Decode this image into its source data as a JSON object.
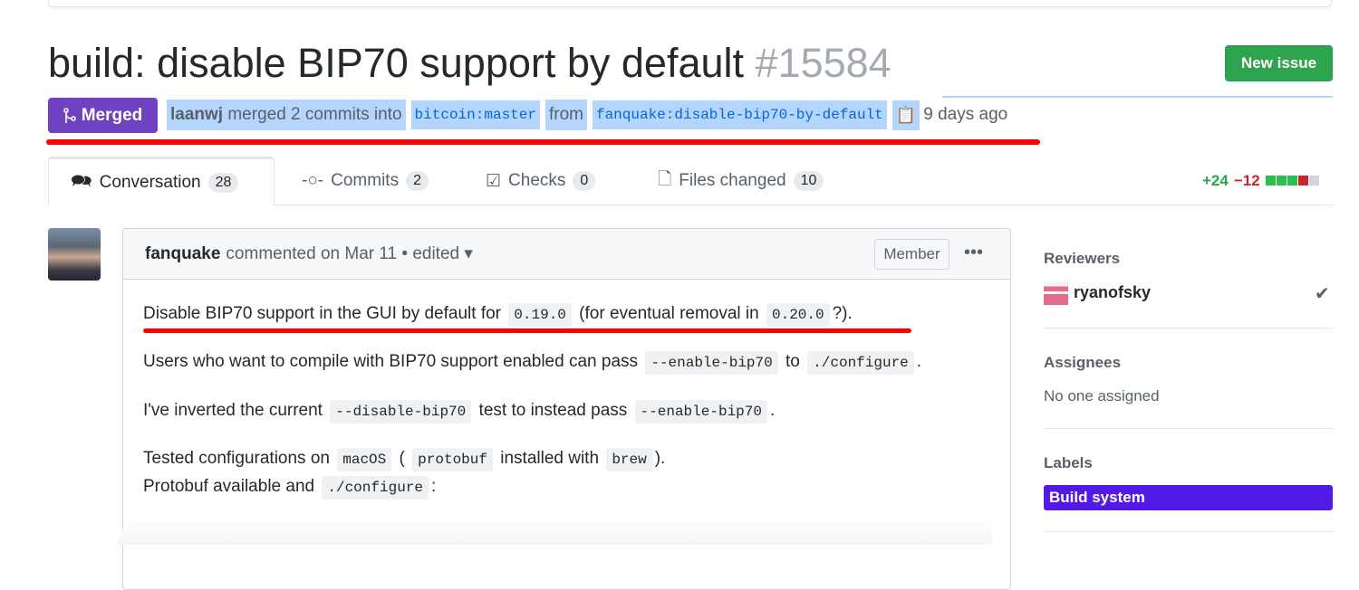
{
  "title": {
    "text": "build: disable BIP70 support by default",
    "number": "#15584"
  },
  "new_issue_label": "New issue",
  "meta": {
    "status": "Merged",
    "user": "laanwj",
    "action": "merged 2 commits into",
    "base": "bitcoin:master",
    "from": "from",
    "head": "fanquake:disable-bip70-by-default",
    "time": "9 days ago"
  },
  "tabs": [
    {
      "label": "Conversation",
      "count": "28",
      "icon": "comment-icon"
    },
    {
      "label": "Commits",
      "count": "2",
      "icon": "commit-icon"
    },
    {
      "label": "Checks",
      "count": "0",
      "icon": "checklist-icon"
    },
    {
      "label": "Files changed",
      "count": "10",
      "icon": "file-diff-icon"
    }
  ],
  "diffstat": {
    "additions": "+24",
    "deletions": "−12",
    "blocks": [
      "green",
      "green",
      "green",
      "red",
      "gray"
    ],
    "colors": {
      "green": "#2cbe4e",
      "red": "#cb2431",
      "gray": "#d1d5da"
    }
  },
  "comment": {
    "author": "fanquake",
    "meta": "commented on Mar 11",
    "edited": "• edited ▾",
    "role": "Member",
    "menu": "•••",
    "p1": {
      "a": "Disable BIP70 support in the GUI by default for",
      "c1": "0.19.0",
      "b": "(for eventual removal in",
      "c2": "0.20.0",
      "d": "?)."
    },
    "p2": {
      "a": "Users who want to compile with BIP70 support enabled can pass",
      "c1": "--enable-bip70",
      "b": "to",
      "c2": "./configure",
      "d": "."
    },
    "p3": {
      "a": "I've inverted the current",
      "c1": "--disable-bip70",
      "b": "test to instead pass",
      "c2": "--enable-bip70",
      "d": "."
    },
    "p4": {
      "a": "Tested configurations on",
      "c1": "macOS",
      "b": "(",
      "c2": "protobuf",
      "d": "installed with",
      "c3": "brew",
      "e": ")."
    },
    "p5": {
      "a": "Protobuf available and",
      "c1": "./configure",
      "b": ":"
    }
  },
  "sidebar": {
    "reviewers_title": "Reviewers",
    "reviewer": "ryanofsky",
    "assignees_title": "Assignees",
    "assignees": "No one assigned",
    "labels_title": "Labels",
    "label": "Build system",
    "label_color": "#5319e7"
  }
}
